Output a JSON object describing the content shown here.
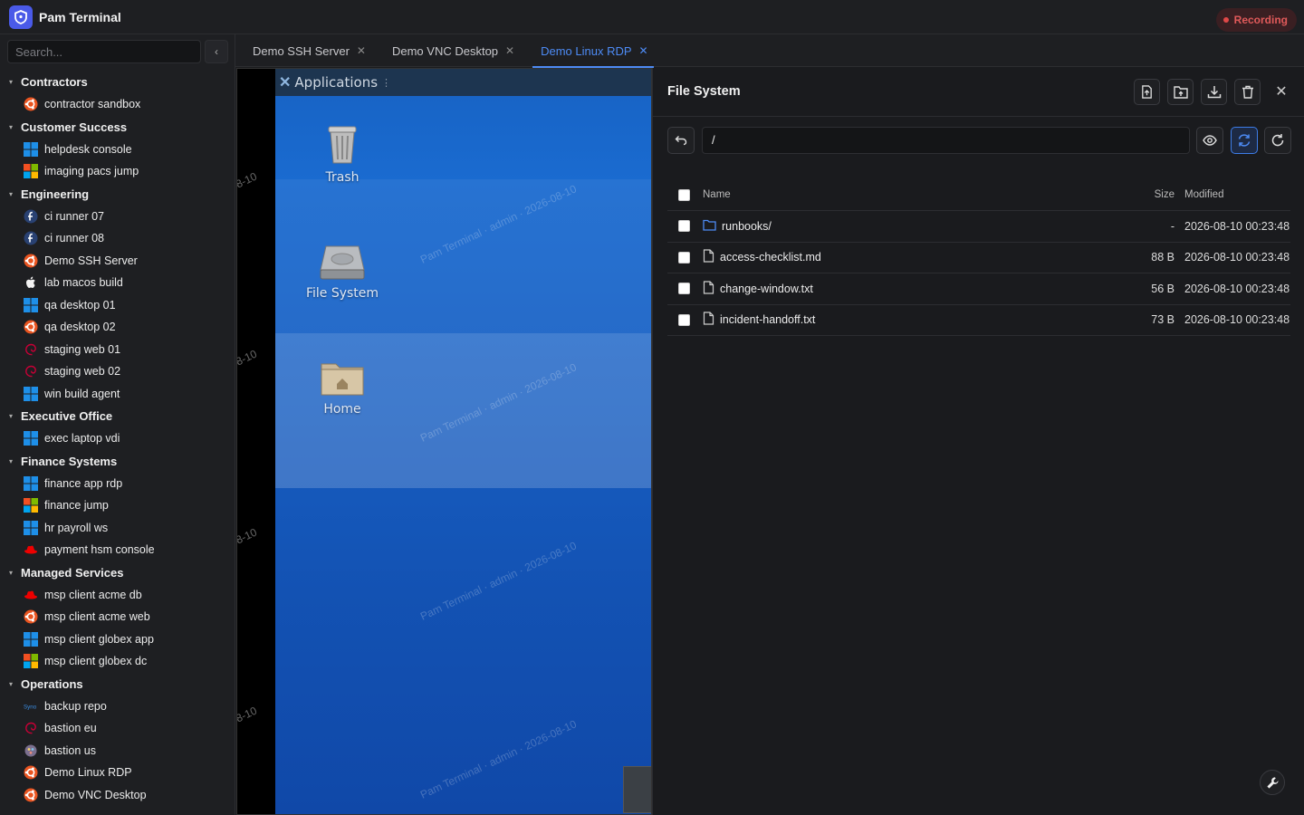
{
  "app": {
    "title": "Pam Terminal",
    "recording_label": "Recording"
  },
  "sidebar": {
    "search_placeholder": "Search...",
    "groups": [
      {
        "label": "Contractors",
        "items": [
          {
            "label": "contractor sandbox",
            "os": "ubuntu-icon"
          }
        ]
      },
      {
        "label": "Customer Success",
        "items": [
          {
            "label": "helpdesk console",
            "os": "windows-icon"
          },
          {
            "label": "imaging pacs jump",
            "os": "windows-color-icon"
          }
        ]
      },
      {
        "label": "Engineering",
        "items": [
          {
            "label": "ci runner 07",
            "os": "fedora-icon"
          },
          {
            "label": "ci runner 08",
            "os": "fedora-icon"
          },
          {
            "label": "Demo SSH Server",
            "os": "ubuntu-icon"
          },
          {
            "label": "lab macos build",
            "os": "apple-icon"
          },
          {
            "label": "qa desktop 01",
            "os": "windows-icon"
          },
          {
            "label": "qa desktop 02",
            "os": "ubuntu-icon"
          },
          {
            "label": "staging web 01",
            "os": "debian-icon"
          },
          {
            "label": "staging web 02",
            "os": "debian-icon"
          },
          {
            "label": "win build agent",
            "os": "windows-icon"
          }
        ]
      },
      {
        "label": "Executive Office",
        "items": [
          {
            "label": "exec laptop vdi",
            "os": "windows-icon"
          }
        ]
      },
      {
        "label": "Finance Systems",
        "items": [
          {
            "label": "finance app rdp",
            "os": "windows-icon"
          },
          {
            "label": "finance jump",
            "os": "windows-color-icon"
          },
          {
            "label": "hr payroll ws",
            "os": "windows-icon"
          },
          {
            "label": "payment hsm console",
            "os": "redhat-icon"
          }
        ]
      },
      {
        "label": "Managed Services",
        "items": [
          {
            "label": "msp client acme db",
            "os": "redhat-icon"
          },
          {
            "label": "msp client acme web",
            "os": "ubuntu-icon"
          },
          {
            "label": "msp client globex app",
            "os": "windows-icon"
          },
          {
            "label": "msp client globex dc",
            "os": "windows-color-icon"
          }
        ]
      },
      {
        "label": "Operations",
        "items": [
          {
            "label": "backup repo",
            "os": "synology-icon"
          },
          {
            "label": "bastion eu",
            "os": "debian-icon"
          },
          {
            "label": "bastion us",
            "os": "generic-linux-icon"
          },
          {
            "label": "Demo Linux RDP",
            "os": "ubuntu-icon"
          },
          {
            "label": "Demo VNC Desktop",
            "os": "ubuntu-icon"
          }
        ]
      }
    ]
  },
  "tabs": [
    {
      "label": "Demo SSH Server",
      "active": false
    },
    {
      "label": "Demo VNC Desktop",
      "active": false
    },
    {
      "label": "Demo Linux RDP",
      "active": true
    }
  ],
  "remote": {
    "applications_label": "Applications",
    "icons": [
      {
        "label": "Trash"
      },
      {
        "label": "File System"
      },
      {
        "label": "Home"
      }
    ],
    "watermark": "Pam Terminal · admin · 2026-08-10",
    "edge_date": "8-10"
  },
  "file_system": {
    "title": "File System",
    "path": "/",
    "columns": {
      "name": "Name",
      "size": "Size",
      "modified": "Modified"
    },
    "rows": [
      {
        "name": "runbooks/",
        "type": "folder",
        "size": "-",
        "modified": "2026-08-10 00:23:48"
      },
      {
        "name": "access-checklist.md",
        "type": "file",
        "size": "88 B",
        "modified": "2026-08-10 00:23:48"
      },
      {
        "name": "change-window.txt",
        "type": "file",
        "size": "56 B",
        "modified": "2026-08-10 00:23:48"
      },
      {
        "name": "incident-handoff.txt",
        "type": "file",
        "size": "73 B",
        "modified": "2026-08-10 00:23:48"
      }
    ]
  },
  "colors": {
    "accent": "#4d8bf5",
    "recording": "#e05a5a",
    "brand": "#4a5ae8"
  }
}
